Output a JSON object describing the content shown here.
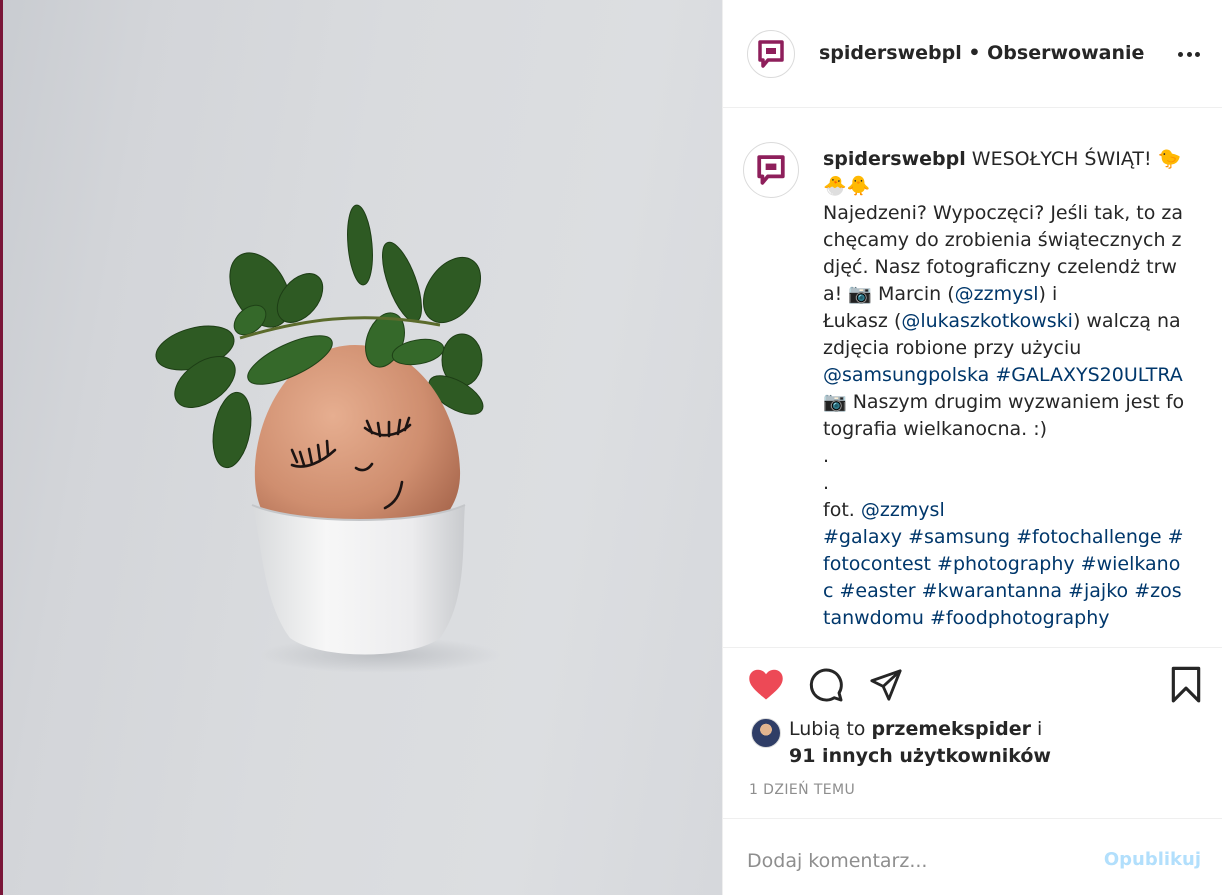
{
  "post": {
    "username": "spiderswebpl",
    "separator": "•",
    "follow_status": "Obserwowanie",
    "more_icon": "more-icon",
    "caption": {
      "username": "spiderswebpl",
      "p1": " WESOŁYCH ŚWIĄT! 🐤🐣🐥\nNajedzeni? Wypoczęci? Jeśli tak, to zachęcamy do zrobienia świątecznych zdjęć. Nasz fotograficzny czelendż trwa! 📷 Marcin (",
      "m1": "@zzmysl",
      "p2": ") i\nŁukasz (",
      "m2": "@lukaszkotkowski",
      "p3": ") walczą na zdjęcia robione przy użyciu\n",
      "m3": "@samsungpolska",
      "p4": " ",
      "m4": "#GALAXYS20ULTRA",
      "p5": "\n📷 Naszym drugim wyzwaniem jest fotografia wielkanocna. :)\n.\n.\nfot. ",
      "m5": "@zzmysl",
      "p6": "\n",
      "tags": "#galaxy #samsung #fotochallenge #fotocontest #photography #wielkanoc #easter #kwarantanna #jajko #zostanwdomu #foodphotography"
    },
    "likes": {
      "prefix": "Lubią to ",
      "user": "przemekspider",
      "suffix": " i",
      "others": "91 innych użytkowników"
    },
    "time_ago": "1 DZIEŃ TEMU",
    "comment": {
      "placeholder": "Dodaj komentarz...",
      "publish_label": "Opublikuj"
    }
  },
  "colors": {
    "brand": "#8e1f5b",
    "like_red": "#ed4956",
    "link": "#00376b",
    "publish_disabled": "#b2dffc",
    "muted": "#8e8e8e"
  },
  "icons": [
    "heart-icon",
    "comment-icon",
    "share-icon",
    "bookmark-icon"
  ]
}
